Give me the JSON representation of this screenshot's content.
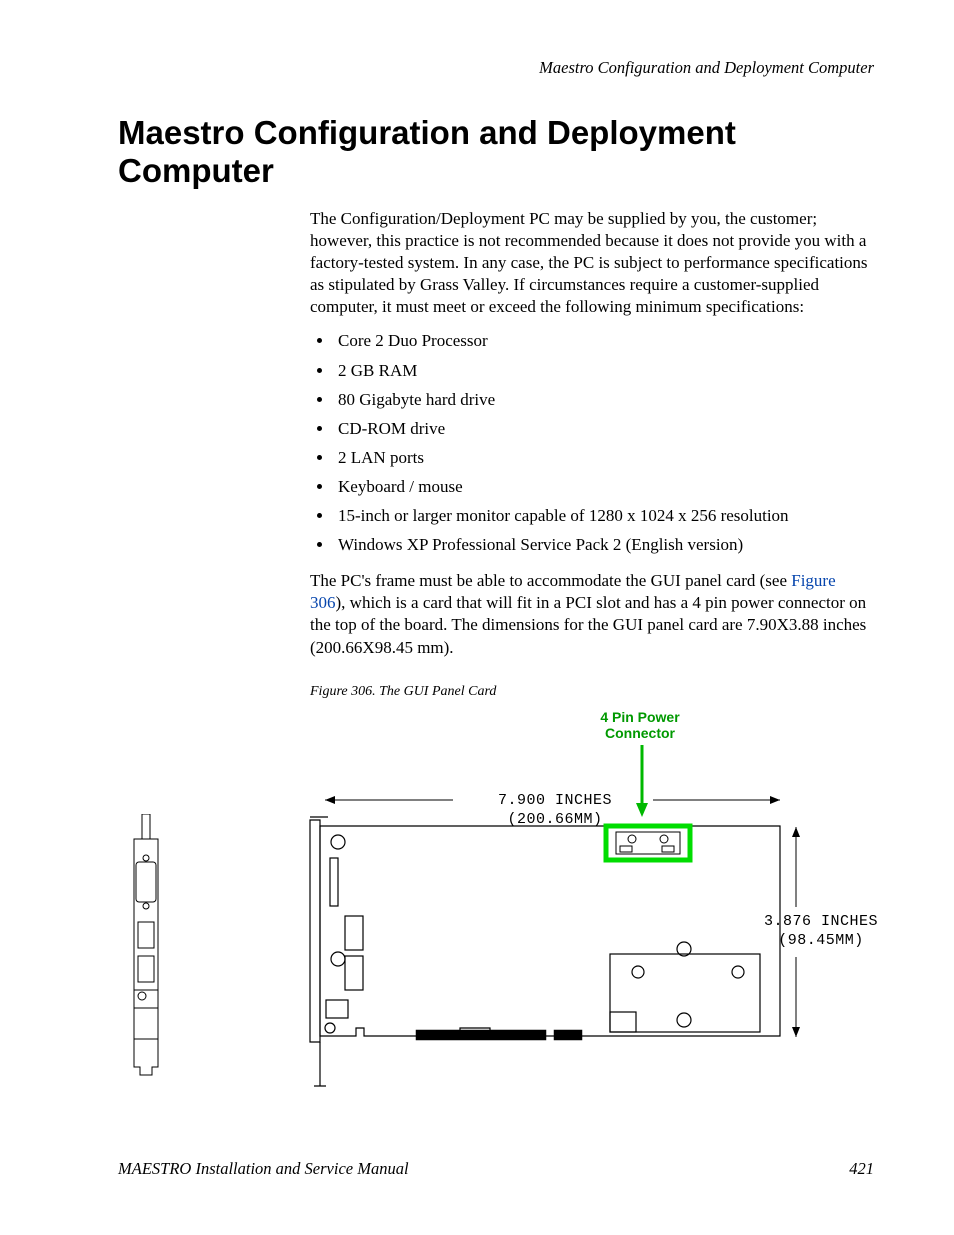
{
  "running_head": "Maestro Configuration and Deployment Computer",
  "title": "Maestro Configuration and Deployment Computer",
  "para1": "The Configuration/Deployment PC may be supplied by you, the customer; however, this practice is not recommended because it does not provide you with a factory-tested system. In any case, the PC is subject to performance specifications as stipulated by Grass Valley. If circumstances require a customer-supplied computer, it must meet or exceed the following minimum specifications:",
  "specs": [
    "Core 2 Duo Processor",
    "2 GB RAM",
    "80 Gigabyte hard drive",
    "CD-ROM drive",
    "2 LAN ports",
    "Keyboard / mouse",
    "15-inch or larger monitor capable of 1280 x 1024 x 256 resolution",
    "Windows XP Professional Service Pack 2 (English version)"
  ],
  "para2_pre": "The PC's frame must be able to accommodate the GUI panel card (see ",
  "para2_link": "Figure 306",
  "para2_post": "), which is a card that will fit in a PCI slot and has a 4 pin power connector on the top of the board. The dimensions for the GUI panel card are 7.90X3.88 inches (200.66X98.45 mm).",
  "fig_caption": "Figure 306.  The GUI Panel Card",
  "callout": {
    "line1": "4 Pin Power",
    "line2": "Connector"
  },
  "dim_width": "7.900 INCHES (200.66MM)",
  "dim_height_l1": "3.876 INCHES",
  "dim_height_l2": "(98.45MM)",
  "footer_left": "MAESTRO Installation and Service Manual",
  "footer_right": "421"
}
